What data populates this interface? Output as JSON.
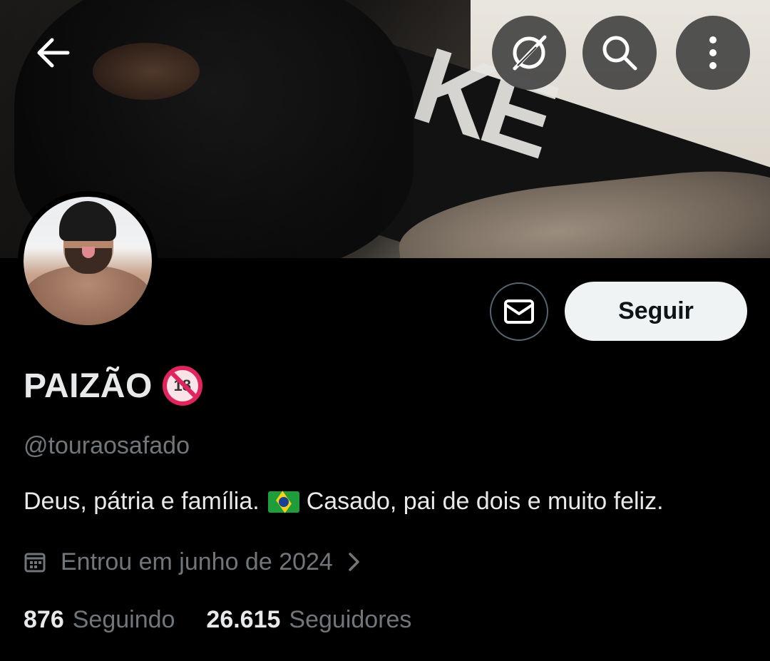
{
  "header": {
    "back_icon": "arrow-left-icon",
    "grok_icon": "grok-icon",
    "search_icon": "search-icon",
    "more_icon": "more-vertical-icon"
  },
  "profile": {
    "display_name": "PAIZÃO",
    "badge_emoji": "no-one-under-18-emoji",
    "badge_text": "18",
    "handle": "@touraosafado",
    "bio_part1": "Deus, pátria e família.",
    "bio_flag": "brazil-flag-emoji",
    "bio_part2": "Casado, pai de dois e muito feliz.",
    "joined": "Entrou em junho de 2024",
    "following_count": "876",
    "following_label": "Seguindo",
    "followers_count": "26.615",
    "followers_label": "Seguidores"
  },
  "actions": {
    "message_icon": "envelope-icon",
    "follow_label": "Seguir"
  },
  "colors": {
    "background": "#000000",
    "primary_text": "#e7e9ea",
    "secondary_text": "#71767b",
    "follow_button_bg": "#eff3f4",
    "follow_button_text": "#0f1419",
    "nav_button_bg": "#3c3c3c",
    "badge_red": "#e0245e"
  }
}
